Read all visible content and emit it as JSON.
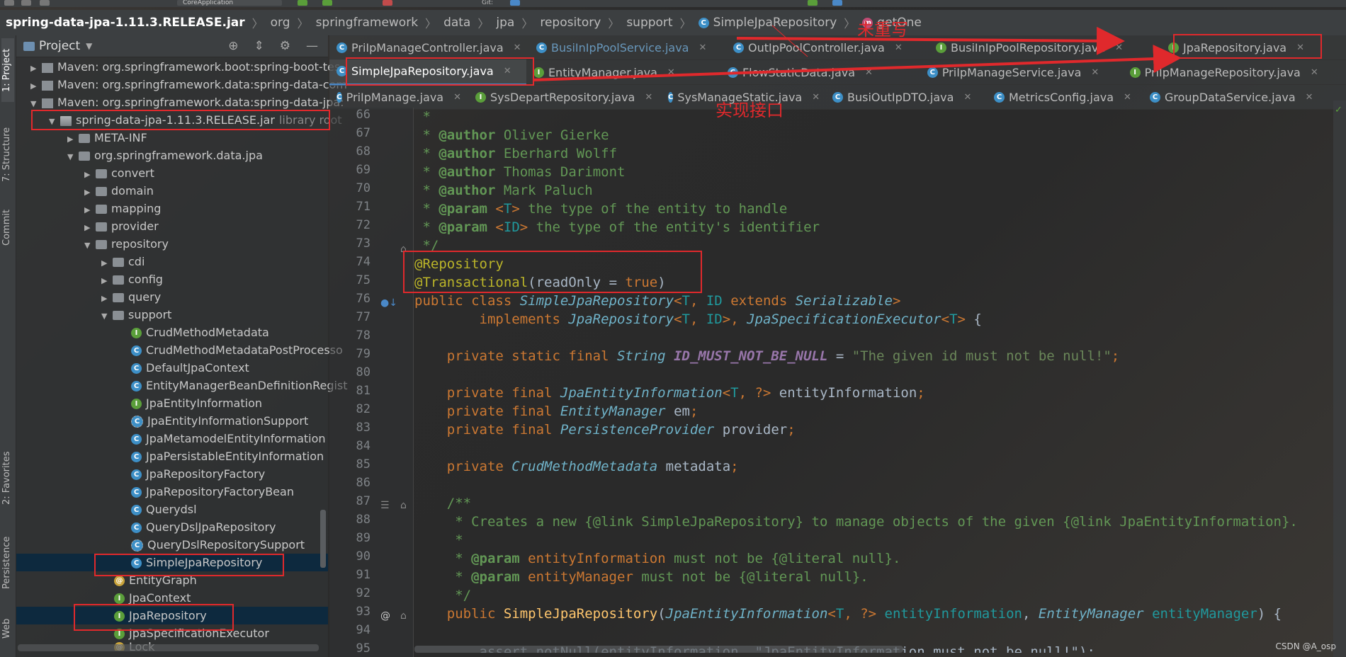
{
  "breadcrumb": {
    "items": [
      "spring-data-jpa-1.11.3.RELEASE.jar",
      "org",
      "springframework",
      "data",
      "jpa",
      "repository",
      "support"
    ],
    "class_name": "SimpleJpaRepository",
    "method_name": "getOne",
    "run_config": "CoreApplication",
    "git_label": "Git:"
  },
  "sidebar_tabs": [
    "1: Project",
    "7: Structure",
    "Commit",
    "2: Favorites",
    "Persistence",
    "Web"
  ],
  "project_panel": {
    "title": "Project",
    "tree": [
      {
        "label": "Maven: org.springframework.boot:spring-boot-tes"
      },
      {
        "label": "Maven: org.springframework.data:spring-data-com"
      },
      {
        "label": "Maven: org.springframework.data:spring-data-jpa:"
      },
      {
        "label": "spring-data-jpa-1.11.3.RELEASE.jar",
        "extra": "library root"
      },
      {
        "label": "META-INF"
      },
      {
        "label": "org.springframework.data.jpa"
      },
      {
        "label": "convert"
      },
      {
        "label": "domain"
      },
      {
        "label": "mapping"
      },
      {
        "label": "provider"
      },
      {
        "label": "repository"
      },
      {
        "label": "cdi"
      },
      {
        "label": "config"
      },
      {
        "label": "query"
      },
      {
        "label": "support"
      },
      {
        "label": "CrudMethodMetadata"
      },
      {
        "label": "CrudMethodMetadataPostProcesso"
      },
      {
        "label": "DefaultJpaContext"
      },
      {
        "label": "EntityManagerBeanDefinitionRegist"
      },
      {
        "label": "JpaEntityInformation"
      },
      {
        "label": "JpaEntityInformationSupport"
      },
      {
        "label": "JpaMetamodelEntityInformation"
      },
      {
        "label": "JpaPersistableEntityInformation"
      },
      {
        "label": "JpaRepositoryFactory"
      },
      {
        "label": "JpaRepositoryFactoryBean"
      },
      {
        "label": "Querydsl"
      },
      {
        "label": "QueryDslJpaRepository"
      },
      {
        "label": "QueryDslRepositorySupport"
      },
      {
        "label": "SimpleJpaRepository"
      },
      {
        "label": "EntityGraph"
      },
      {
        "label": "JpaContext"
      },
      {
        "label": "JpaRepository"
      },
      {
        "label": "JpaSpecificationExecutor"
      },
      {
        "label": "Lock"
      }
    ]
  },
  "tabs": {
    "row1": [
      "PriIpManageController.java",
      "BusiInIpPoolService.java",
      "OutIpPoolController.java",
      "BusiInIpPoolRepository.java",
      "JpaRepository.java"
    ],
    "row2": [
      "SimpleJpaRepository.java",
      "EntityManager.java",
      "FlowStaticData.java",
      "PriIpManageService.java",
      "PriIpManageRepository.java"
    ],
    "row3": [
      "PriIpManage.java",
      "SysDepartRepository.java",
      "SysManageStatic.java",
      "BusiOutIpDTO.java",
      "MetricsConfig.java",
      "GroupDataService.java"
    ]
  },
  "annotations": {
    "not_overridden": "未重写",
    "implements_interface": "实现接口"
  },
  "code": {
    "line_numbers": [
      "66",
      "67",
      "68",
      "69",
      "70",
      "71",
      "72",
      "73",
      "74",
      "75",
      "76",
      "77",
      "78",
      "79",
      "80",
      "81",
      "82",
      "83",
      "84",
      "85",
      "86",
      "87",
      "88",
      "89",
      "90",
      "91",
      "92",
      "93",
      "94",
      "95"
    ],
    "authors": [
      "Oliver Gierke",
      "Eberhard Wolff",
      "Thomas Darimont",
      "Mark Paluch"
    ],
    "param_t": "the type of the entity to handle",
    "param_id": "the type of the entity's identifier",
    "annotation_repository": "@Repository",
    "annotation_transactional": "@Transactional",
    "readonly": "readOnly",
    "true_kw": "true",
    "class_name": "SimpleJpaRepository",
    "generic_t": "T",
    "generic_id": "ID",
    "serializable": "Serializable",
    "jpa_repository": "JpaRepository",
    "jpa_spec_executor": "JpaSpecificationExecutor",
    "const_name": "ID_MUST_NOT_BE_NULL",
    "const_value": "\"The given id must not be null!\"",
    "entity_info_type": "JpaEntityInformation",
    "entity_info_field": "entityInformation",
    "em_type": "EntityManager",
    "em_field": "em",
    "provider_type": "PersistenceProvider",
    "provider_field": "provider",
    "metadata_type": "CrudMethodMetadata",
    "metadata_field": "metadata",
    "doc_creates": " * Creates a new {@link SimpleJpaRepository} to manage objects of the given {@link JpaEntityInformation}.",
    "doc_param1": "entityInformation",
    "doc_param1_text": "must not be {@literal null}.",
    "doc_param2": "entityManager",
    "doc_param2_text": "must not be {@literal null}.",
    "ctor_name": "SimpleJpaRepository",
    "ctor_p1": "entityInformation",
    "ctor_p2": "entityManager",
    "line95": "assert notNull(entityInformation, \"JpaEntityInformation must not be null!\");"
  },
  "watermark": "CSDN @A_osp"
}
